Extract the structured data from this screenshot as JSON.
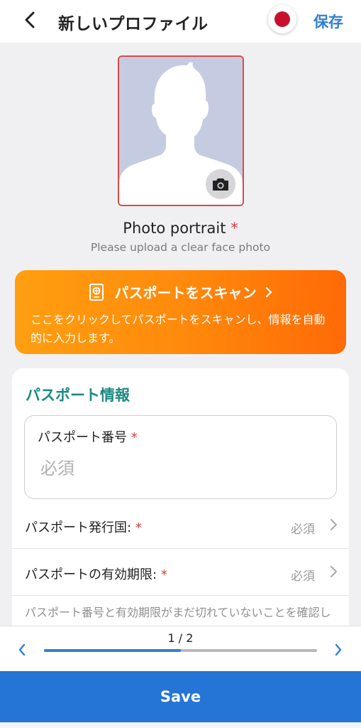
{
  "header": {
    "title": "新しいプロファイル",
    "save_label": "保存",
    "flag_color": "#c8102e"
  },
  "photo": {
    "label": "Photo portrait",
    "required_mark": "*",
    "hint": "Please upload a clear face photo",
    "camera_icon": "camera-icon"
  },
  "scan_banner": {
    "title": "パスポートをスキャン",
    "description": "ここをクリックしてパスポートをスキャンし、情報を自動的に入力します。",
    "icon": "passport-icon",
    "colors": [
      "#ff9f10",
      "#ff6a06"
    ]
  },
  "passport_section": {
    "title": "パスポート情報",
    "number_field": {
      "label": "パスポート番号",
      "required_mark": "*",
      "placeholder": "必須",
      "value": ""
    },
    "country_row": {
      "label": "パスポート発行国:",
      "required_mark": "*",
      "value": "必須"
    },
    "expiry_row": {
      "label": "パスポートの有効期限:",
      "required_mark": "*",
      "value": "必須"
    },
    "note": "パスポート番号と有効期限がまだ切れていないことを確認してください。"
  },
  "pager": {
    "indicator": "1 / 2",
    "progress": 0.5
  },
  "save_button": {
    "label": "Save"
  },
  "colors": {
    "accent_blue": "#2f7fd4",
    "save_bar": "#2575d6",
    "section_teal": "#1a8a82",
    "required_red": "#d63b3b"
  }
}
